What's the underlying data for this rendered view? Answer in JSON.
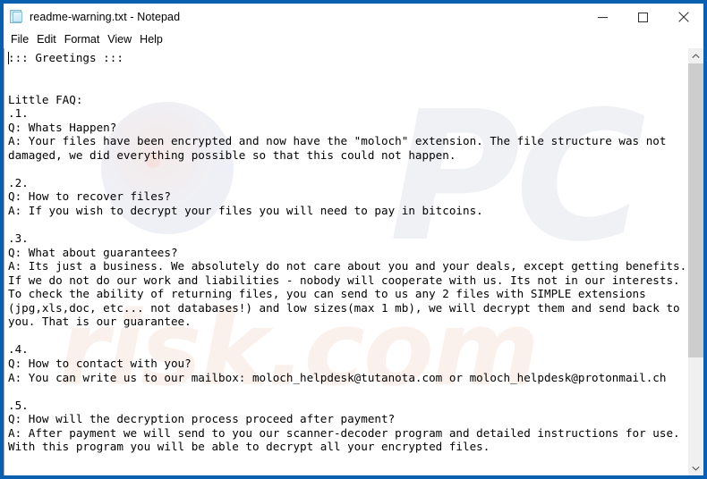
{
  "window": {
    "title": "readme-warning.txt - Notepad",
    "icon": "notepad-document-icon",
    "border_color": "#0a60b0",
    "controls": {
      "minimize_label": "Minimize",
      "maximize_label": "Maximize",
      "close_label": "Close"
    }
  },
  "menu": {
    "items": [
      {
        "label": "File"
      },
      {
        "label": "Edit"
      },
      {
        "label": "Format"
      },
      {
        "label": "View"
      },
      {
        "label": "Help"
      }
    ]
  },
  "document": {
    "filename": "readme-warning.txt",
    "body": "::: Greetings :::\n\n\nLittle FAQ:\n.1.\nQ: Whats Happen?\nA: Your files have been encrypted and now have the \"moloch\" extension. The file structure was not\ndamaged, we did everything possible so that this could not happen.\n\n.2.\nQ: How to recover files?\nA: If you wish to decrypt your files you will need to pay in bitcoins.\n\n.3.\nQ: What about guarantees?\nA: Its just a business. We absolutely do not care about you and your deals, except getting benefits.\nIf we do not do our work and liabilities - nobody will cooperate with us. Its not in our interests.\nTo check the ability of returning files, you can send to us any 2 files with SIMPLE extensions\n(jpg,xls,doc, etc... not databases!) and low sizes(max 1 mb), we will decrypt them and send back to\nyou. That is our guarantee.\n\n.4.\nQ: How to contact with you?\nA: You can write us to our mailbox: moloch_helpdesk@tutanota.com or moloch_helpdesk@protonmail.ch\n\n.5.\nQ: How will the decryption process proceed after payment?\nA: After payment we will send to you our scanner-decoder program and detailed instructions for use.\nWith this program you will be able to decrypt all your encrypted files.",
    "ransom_extension": "moloch",
    "contact_emails": [
      "moloch_helpdesk@tutanota.com",
      "moloch_helpdesk@protonmail.ch"
    ]
  },
  "watermark": {
    "big_text": "PC",
    "small_text": "risk.com"
  },
  "scrollbar": {
    "up_arrow": "chevron-up-icon",
    "down_arrow": "chevron-down-icon",
    "thumb_position_percent": 0
  }
}
